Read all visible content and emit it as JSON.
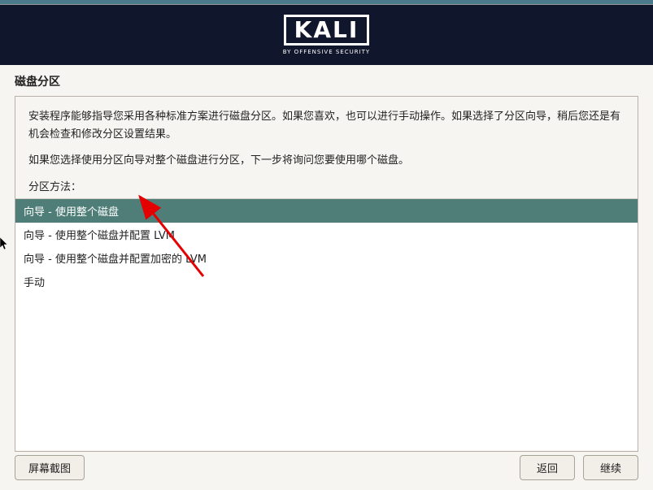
{
  "logo": {
    "main": "KALI",
    "sub": "BY OFFENSIVE SECURITY"
  },
  "page_title": "磁盘分区",
  "description1": "安装程序能够指导您采用各种标准方案进行磁盘分区。如果您喜欢，也可以进行手动操作。如果选择了分区向导，稍后您还是有机会检查和修改分区设置结果。",
  "description2": "如果您选择使用分区向导对整个磁盘进行分区，下一步将询问您要使用哪个磁盘。",
  "method_label": "分区方法：",
  "options": [
    "向导 - 使用整个磁盘",
    "向导 - 使用整个磁盘并配置 LVM",
    "向导 - 使用整个磁盘并配置加密的 LVM",
    "手动"
  ],
  "buttons": {
    "screenshot": "屏幕截图",
    "back": "返回",
    "continue": "继续"
  }
}
